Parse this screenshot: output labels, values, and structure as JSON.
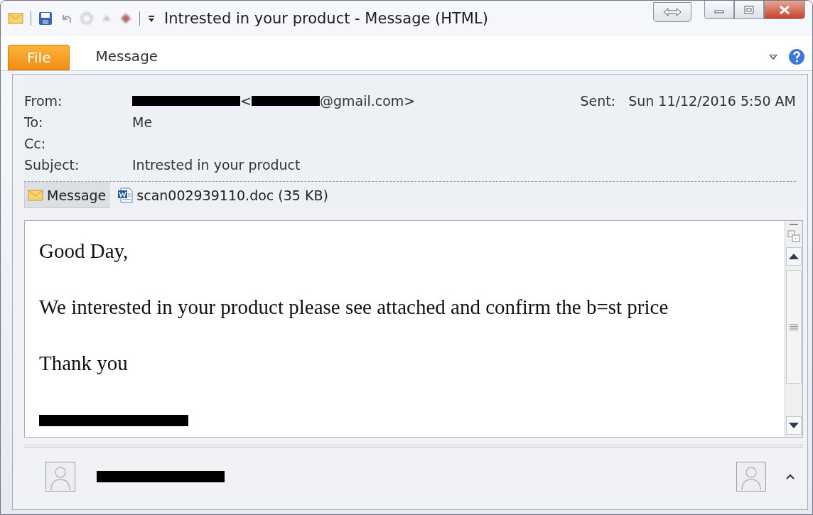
{
  "window": {
    "title": "Intrested in your product  -  Message (HTML)"
  },
  "ribbon_tabs": [
    {
      "label": "File",
      "kind": "file",
      "selected": false
    },
    {
      "label": "Message",
      "kind": "tab",
      "selected": true
    }
  ],
  "header": {
    "from": {
      "label": "From:",
      "address_prefix": "<",
      "address_suffix": "@gmail.com>"
    },
    "sent": {
      "label": "Sent:",
      "value": "Sun 11/12/2016 5:50 AM"
    },
    "to": {
      "label": "To:",
      "value": "Me"
    },
    "cc": {
      "label": "Cc:"
    },
    "subject": {
      "label": "Subject:",
      "value": "Intrested in your product"
    }
  },
  "attachments": [
    {
      "label": "Message",
      "kind": "message",
      "selected": true
    },
    {
      "label": "scan002939110.doc (35 KB)",
      "kind": "word",
      "selected": false
    }
  ],
  "body": {
    "paragraphs": [
      "Good Day,",
      "We interested in your product please see attached and confirm the b=st price",
      "Thank you"
    ]
  }
}
